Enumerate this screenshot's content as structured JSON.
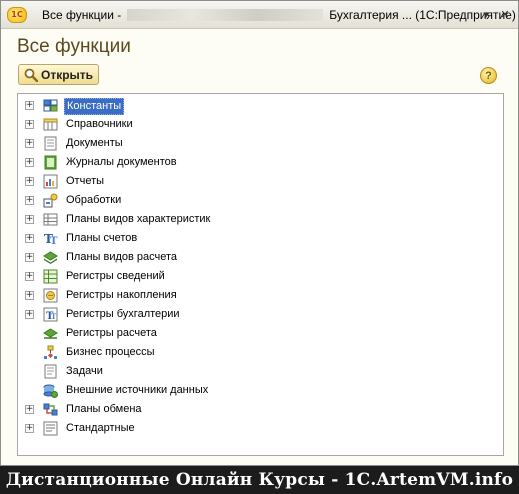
{
  "titlebar": {
    "title_prefix": "Все функции -",
    "title_suffix": "Бухгалтерия ... (1С:Предприятие)",
    "logo_text": "1С",
    "dropdown_glyph": "▾",
    "close_glyph": "✕"
  },
  "page": {
    "heading": "Все функции",
    "open_button": "Открыть",
    "help_glyph": "?"
  },
  "tree": {
    "items": [
      {
        "label": "Константы",
        "expandable": true,
        "selected": true,
        "icon": "constants-icon"
      },
      {
        "label": "Справочники",
        "expandable": true,
        "icon": "catalogs-icon"
      },
      {
        "label": "Документы",
        "expandable": true,
        "icon": "documents-icon"
      },
      {
        "label": "Журналы документов",
        "expandable": true,
        "icon": "document-journals-icon"
      },
      {
        "label": "Отчеты",
        "expandable": true,
        "icon": "reports-icon"
      },
      {
        "label": "Обработки",
        "expandable": true,
        "icon": "data-processors-icon"
      },
      {
        "label": "Планы видов характеристик",
        "expandable": true,
        "icon": "characteristic-types-icon"
      },
      {
        "label": "Планы счетов",
        "expandable": true,
        "icon": "charts-of-accounts-icon"
      },
      {
        "label": "Планы видов расчета",
        "expandable": true,
        "icon": "calculation-types-icon"
      },
      {
        "label": "Регистры сведений",
        "expandable": true,
        "icon": "information-registers-icon"
      },
      {
        "label": "Регистры накопления",
        "expandable": true,
        "icon": "accumulation-registers-icon"
      },
      {
        "label": "Регистры бухгалтерии",
        "expandable": true,
        "icon": "accounting-registers-icon"
      },
      {
        "label": "Регистры расчета",
        "expandable": false,
        "icon": "calculation-registers-icon"
      },
      {
        "label": "Бизнес процессы",
        "expandable": false,
        "icon": "business-processes-icon"
      },
      {
        "label": "Задачи",
        "expandable": false,
        "icon": "tasks-icon"
      },
      {
        "label": "Внешние источники данных",
        "expandable": false,
        "icon": "external-data-sources-icon"
      },
      {
        "label": "Планы обмена",
        "expandable": true,
        "icon": "exchange-plans-icon"
      },
      {
        "label": "Стандартные",
        "expandable": true,
        "icon": "standard-icon"
      }
    ],
    "expander_glyph": "+"
  },
  "footer": {
    "text": "Дистанционные Онлайн Курсы - 1С.ArtemVM.info"
  },
  "colors": {
    "selection": "#3c6dc4",
    "heading": "#5b4a1a",
    "footer_bg": "#1c1c1c"
  }
}
